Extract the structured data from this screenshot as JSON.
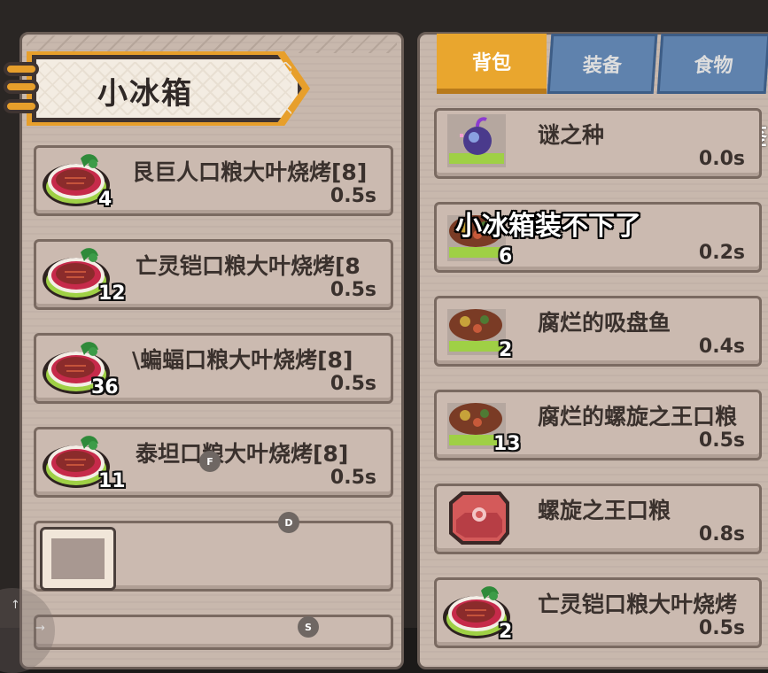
{
  "window": {
    "minimize": "—",
    "maximize": "☐",
    "close": "✕",
    "collapse": "⌄"
  },
  "left_panel": {
    "title": "小冰箱",
    "items": [
      {
        "name": "艮巨人口粮大叶烧烤[8]",
        "time": "0.5s",
        "count": "4",
        "icon": "grilled-meat-leaf-icon"
      },
      {
        "name": "亡灵铠口粮大叶烧烤[8",
        "time": "0.5s",
        "count": "12",
        "icon": "grilled-meat-leaf-icon"
      },
      {
        "name": "\\蝙蝠口粮大叶烧烤[8]",
        "time": "0.5s",
        "count": "36",
        "icon": "grilled-meat-leaf-icon"
      },
      {
        "name": "泰坦口粮大叶烧烤[8]",
        "time": "0.5s",
        "count": "11",
        "icon": "grilled-meat-leaf-icon"
      }
    ]
  },
  "tabs": [
    {
      "label": "背包",
      "active": true
    },
    {
      "label": "装备",
      "active": false
    },
    {
      "label": "食物",
      "active": false
    }
  ],
  "right_panel": {
    "cut_label": "鉴",
    "items": [
      {
        "name": "谜之种",
        "time": "0.0s",
        "count": "",
        "icon": "mystery-seed-icon"
      },
      {
        "name": "",
        "time": "0.2s",
        "count": "6",
        "icon": "rotten-meat-icon"
      },
      {
        "name": "腐烂的吸盘鱼",
        "time": "0.4s",
        "count": "2",
        "icon": "rotten-meat-icon"
      },
      {
        "name": "腐烂的螺旋之王口粮",
        "time": "0.5s",
        "count": "13",
        "icon": "rotten-meat-icon"
      },
      {
        "name": "螺旋之王口粮",
        "time": "0.8s",
        "count": "",
        "icon": "raw-steak-icon"
      },
      {
        "name": "亡灵铠口粮大叶烧烤",
        "time": "0.5s",
        "count": "2",
        "icon": "grilled-meat-leaf-icon"
      }
    ]
  },
  "message": "小冰箱装不下了",
  "keys": {
    "f": "F",
    "d": "D",
    "s": "S"
  },
  "joystick": {
    "up": "↑",
    "right": "→"
  },
  "colors": {
    "accent": "#e9a62e",
    "titlebar": "#0aa7e9",
    "tab_inactive": "#5f82ad"
  }
}
